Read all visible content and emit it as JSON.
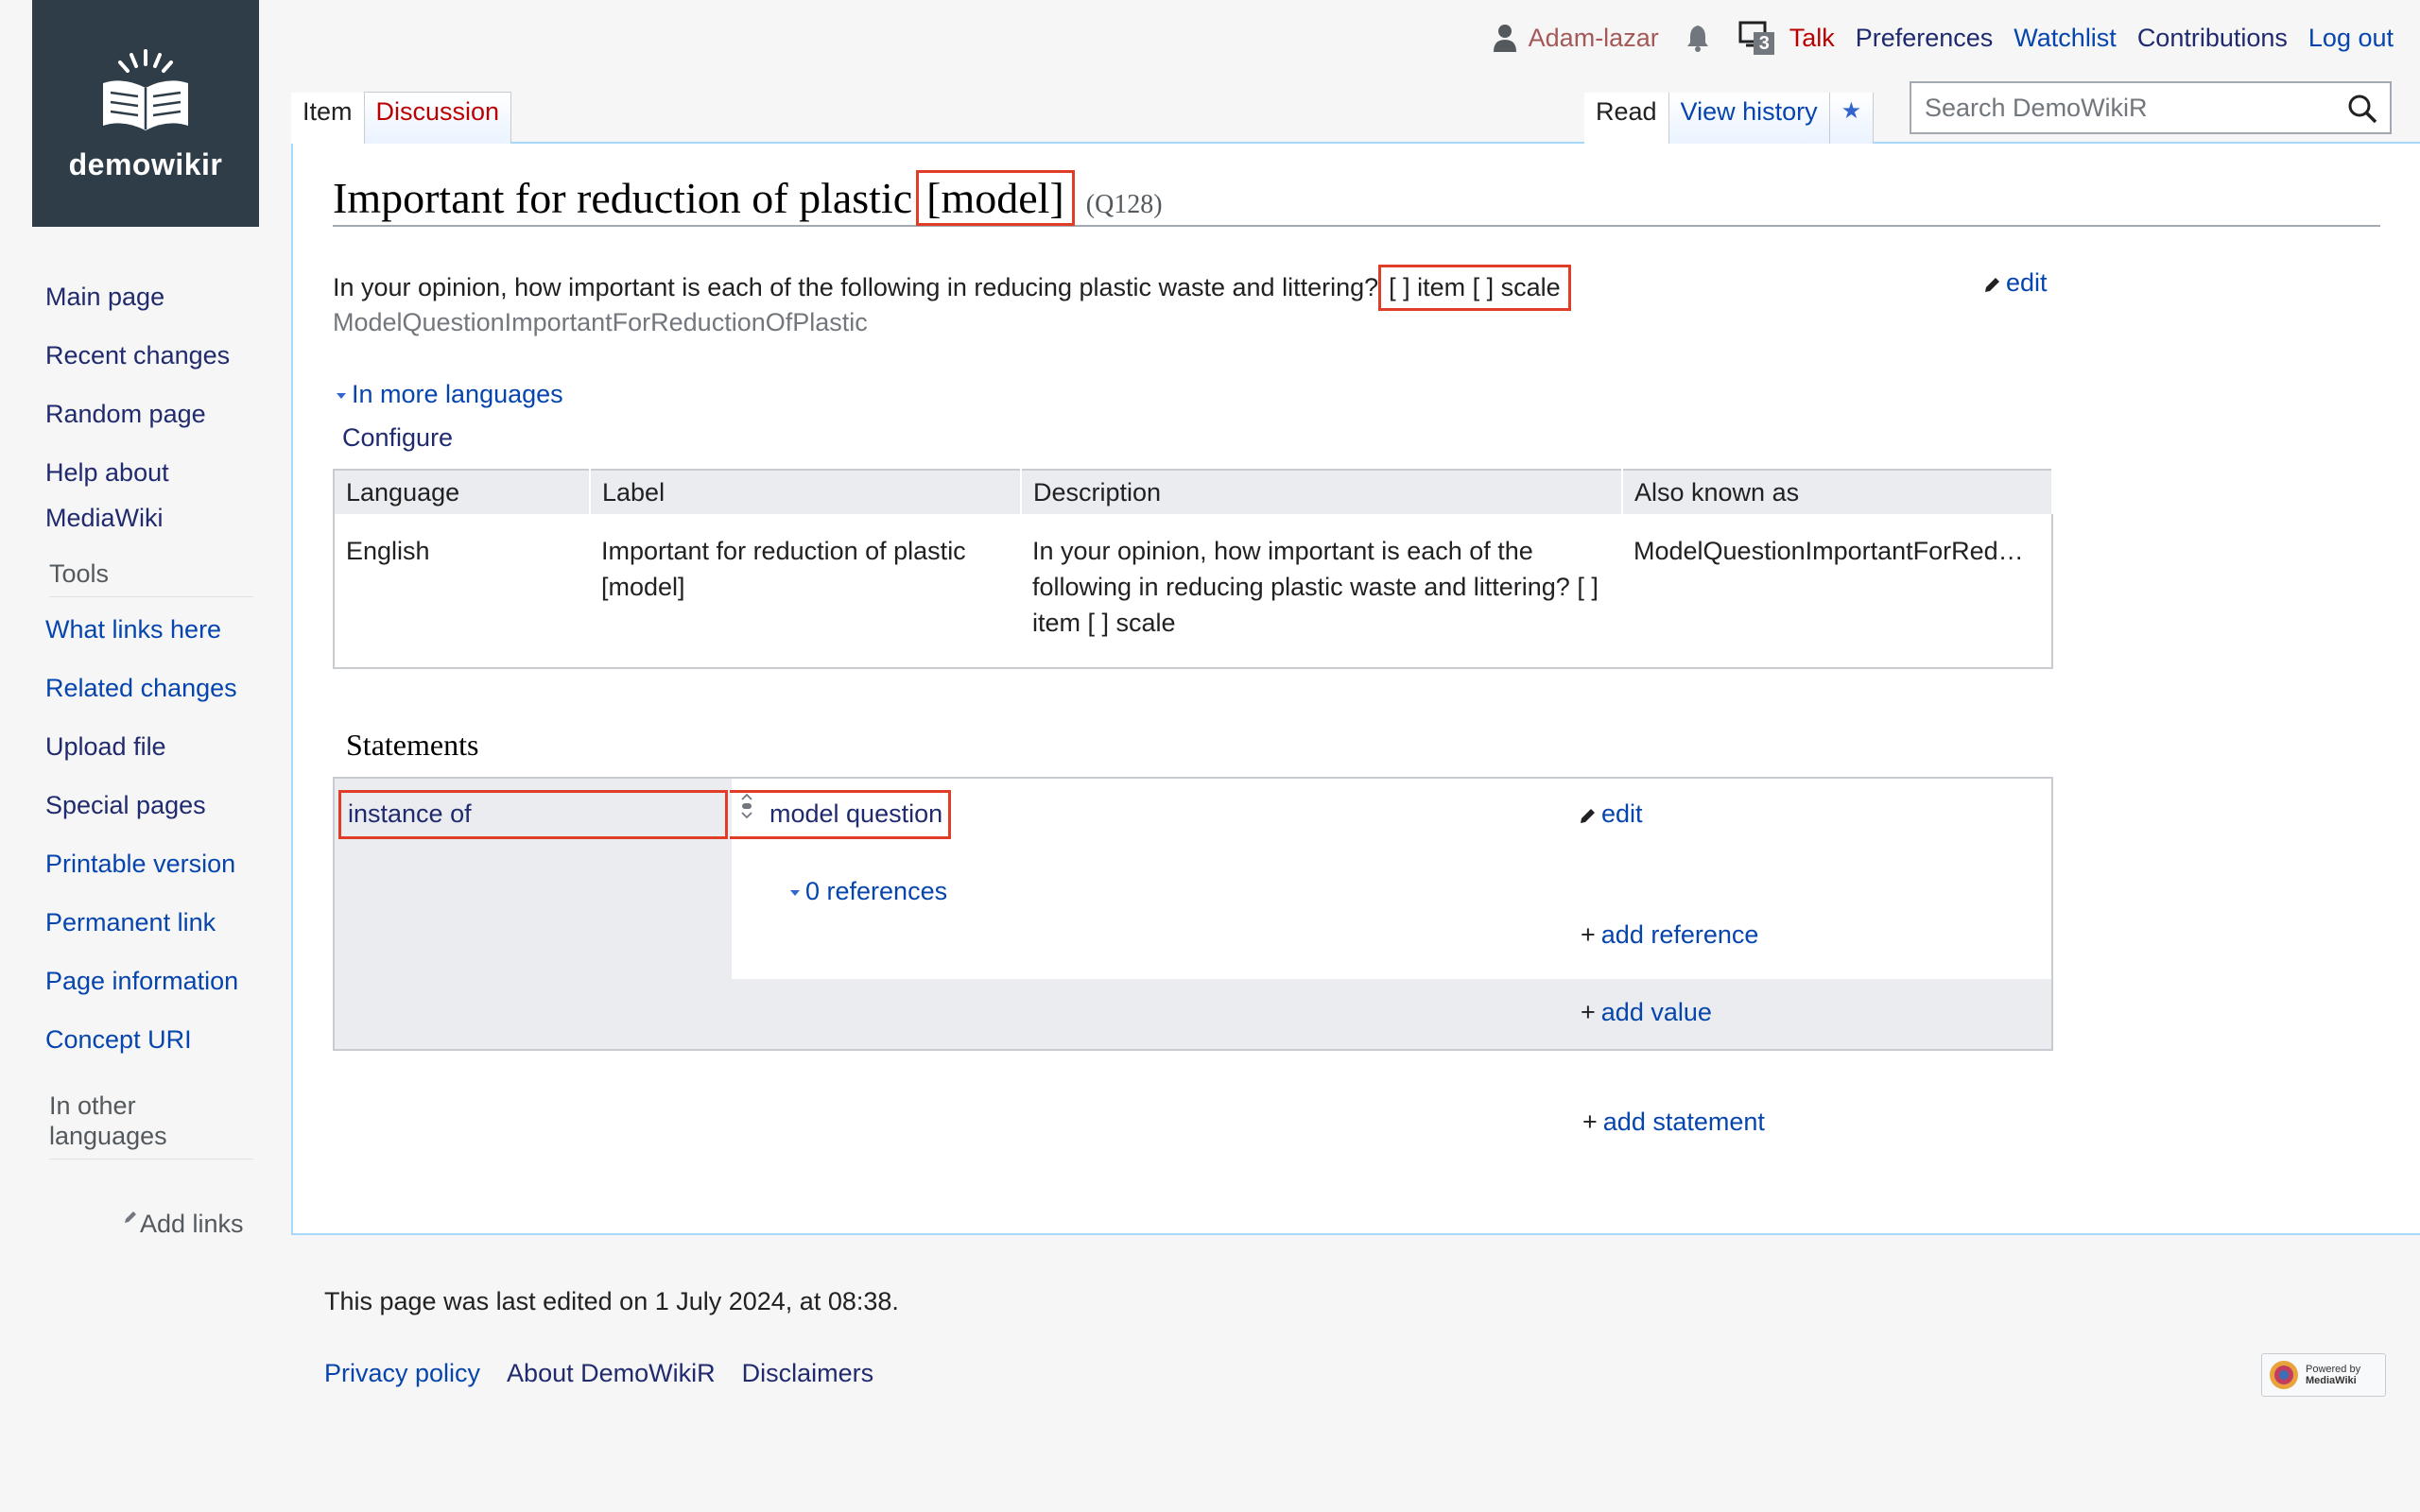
{
  "logo": {
    "text": "demowikir"
  },
  "personal": {
    "username": "Adam-lazar",
    "notifications_count": "3",
    "talk": "Talk",
    "preferences": "Preferences",
    "watchlist": "Watchlist",
    "contributions": "Contributions",
    "logout": "Log out"
  },
  "tabs": {
    "item": "Item",
    "discussion": "Discussion",
    "read": "Read",
    "view_history": "View history",
    "watch_star": "★"
  },
  "search": {
    "placeholder": "Search DemoWikiR"
  },
  "sidebar": {
    "main_page": "Main page",
    "recent_changes": "Recent changes",
    "random_page": "Random page",
    "help_line1": "Help about",
    "help_line2": "MediaWiki",
    "tools_heading": "Tools",
    "tools": [
      "What links here",
      "Related changes",
      "Upload file",
      "Special pages",
      "Printable version",
      "Permanent link",
      "Page information",
      "Concept URI"
    ],
    "other_lang_line1": "In other",
    "other_lang_line2": "languages",
    "add_links": "Add links"
  },
  "item": {
    "title_main": "Important for reduction of plastic",
    "title_highlight": "[model]",
    "qid": "(Q128)",
    "description_main": "In your opinion, how important is each of the following in reducing plastic waste and littering?",
    "description_highlight": "[ ] item [ ] scale",
    "aliases": "ModelQuestionImportantForReductionOfPlastic",
    "edit": "edit",
    "in_more_languages": "In more languages",
    "configure": "Configure"
  },
  "lang_table": {
    "headers": [
      "Language",
      "Label",
      "Description",
      "Also known as"
    ],
    "rows": [
      {
        "language": "English",
        "label": "Important for reduction of plastic [model]",
        "description": "In your opinion, how important is each of the following in reducing plastic waste and littering? [ ] item [ ] scale",
        "aliases": "ModelQuestionImportantForRed…"
      }
    ]
  },
  "statements": {
    "heading": "Statements",
    "property": "instance of",
    "value": "model question",
    "edit": "edit",
    "references": "0 references",
    "add_reference": "add reference",
    "add_value": "add value",
    "add_statement": "add statement"
  },
  "footer": {
    "last_edited": "This page was last edited on 1 July 2024, at 08:38.",
    "privacy": "Privacy policy",
    "about": "About DemoWikiR",
    "disclaimers": "Disclaimers",
    "powered_line1": "Powered by",
    "powered_line2": "MediaWiki"
  }
}
